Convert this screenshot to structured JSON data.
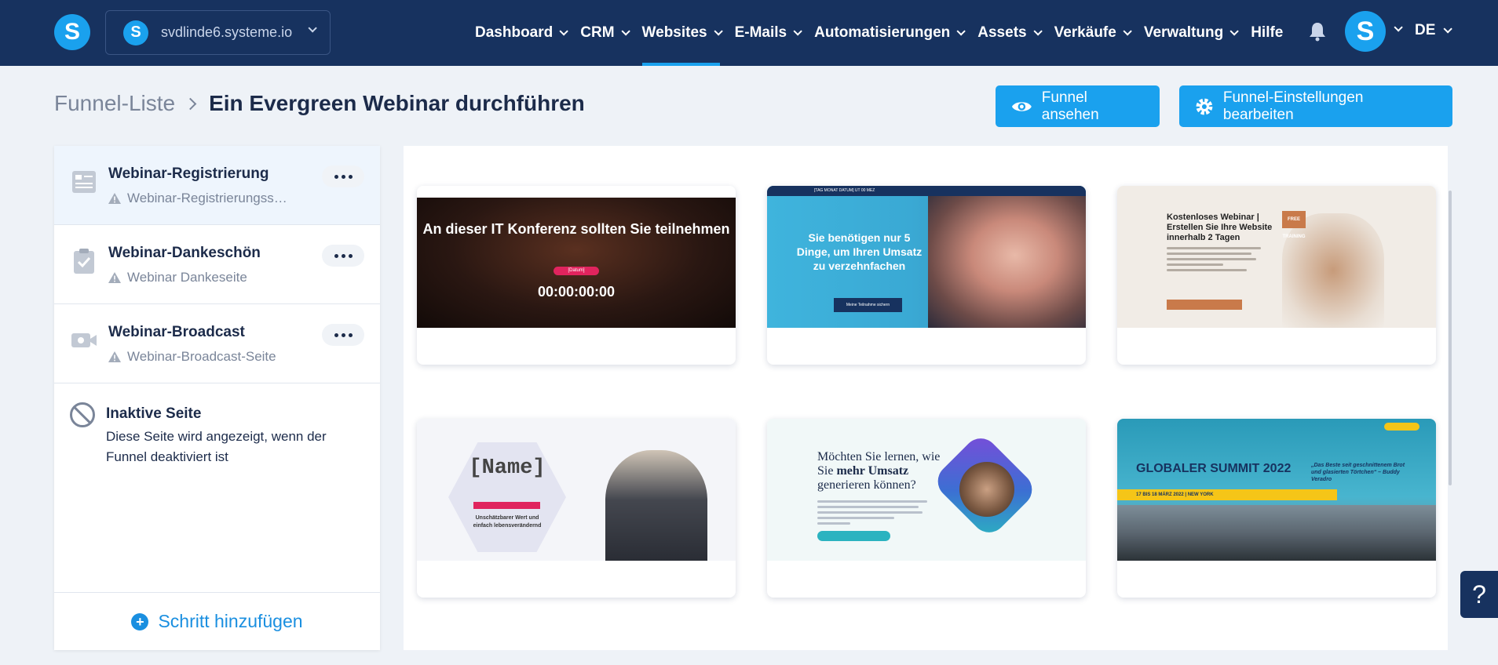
{
  "app": {
    "logo_letter": "S"
  },
  "header": {
    "domain": "svdlinde6.systeme.io",
    "nav": [
      {
        "label": "Dashboard",
        "dropdown": true,
        "active": false
      },
      {
        "label": "CRM",
        "dropdown": true,
        "active": false
      },
      {
        "label": "Websites",
        "dropdown": true,
        "active": true
      },
      {
        "label": "E-Mails",
        "dropdown": true,
        "active": false
      },
      {
        "label": "Automatisierungen",
        "dropdown": true,
        "active": false
      },
      {
        "label": "Assets",
        "dropdown": true,
        "active": false
      },
      {
        "label": "Verkäufe",
        "dropdown": true,
        "active": false
      },
      {
        "label": "Verwaltung",
        "dropdown": true,
        "active": false
      },
      {
        "label": "Hilfe",
        "dropdown": false,
        "active": false
      }
    ],
    "avatar_letter": "S",
    "language": "DE"
  },
  "breadcrumb": {
    "parent": "Funnel-Liste",
    "current": "Ein Evergreen Webinar durchführen"
  },
  "actions": {
    "view_funnel": "Funnel ansehen",
    "edit_settings": "Funnel-Einstellungen bearbeiten"
  },
  "steps": [
    {
      "title": "Webinar-Registrierung",
      "subtitle": "Webinar-Registrierungss…",
      "icon": "page-icon",
      "selected": true
    },
    {
      "title": "Webinar-Dankeschön",
      "subtitle": "Webinar Dankeseite",
      "icon": "clipboard-check-icon",
      "selected": false
    },
    {
      "title": "Webinar-Broadcast",
      "subtitle": "Webinar-Broadcast-Seite",
      "icon": "video-camera-icon",
      "selected": false
    }
  ],
  "inactive": {
    "title": "Inaktive Seite",
    "text": "Diese Seite wird angezeigt, wenn der Funnel deaktiviert ist"
  },
  "add_step": "Schritt hinzufügen",
  "templates": [
    {
      "headline": "An dieser IT Konferenz sollten Sie teilnehmen",
      "pill": "[Datum]",
      "timer": "00:00:00:00"
    },
    {
      "topbar": "[TAG MONAT DATUM] UT 00 MEZ",
      "headline": "Sie benötigen nur 5 Dinge, um Ihren Umsatz zu verzehnfachen",
      "button": "Meine Teilnahme sichern"
    },
    {
      "headline": "Kostenloses Webinar | Erstellen Sie Ihre Website innerhalb 2 Tagen",
      "badge": "FREE TRAINING"
    },
    {
      "headline": "[Name]",
      "sub": "Unschätzbarer Wert und einfach lebensverändernd"
    },
    {
      "headline_pre": "Möchten Sie lernen, wie Sie ",
      "headline_bold": "mehr Umsatz",
      "headline_post": " generieren können?"
    },
    {
      "headline": "GLOBALER SUMMIT 2022",
      "band": "17 BIS 18 MÄRZ 2022 | NEW YORK",
      "quote": "„Das Beste seit geschnittenem Brot und glasierten Törtchen“ – Buddy Veradro"
    }
  ],
  "help_label": "?",
  "colors": {
    "nav_bg": "#17325f",
    "accent": "#1aa1ee",
    "page_bg": "#eef2f7"
  }
}
